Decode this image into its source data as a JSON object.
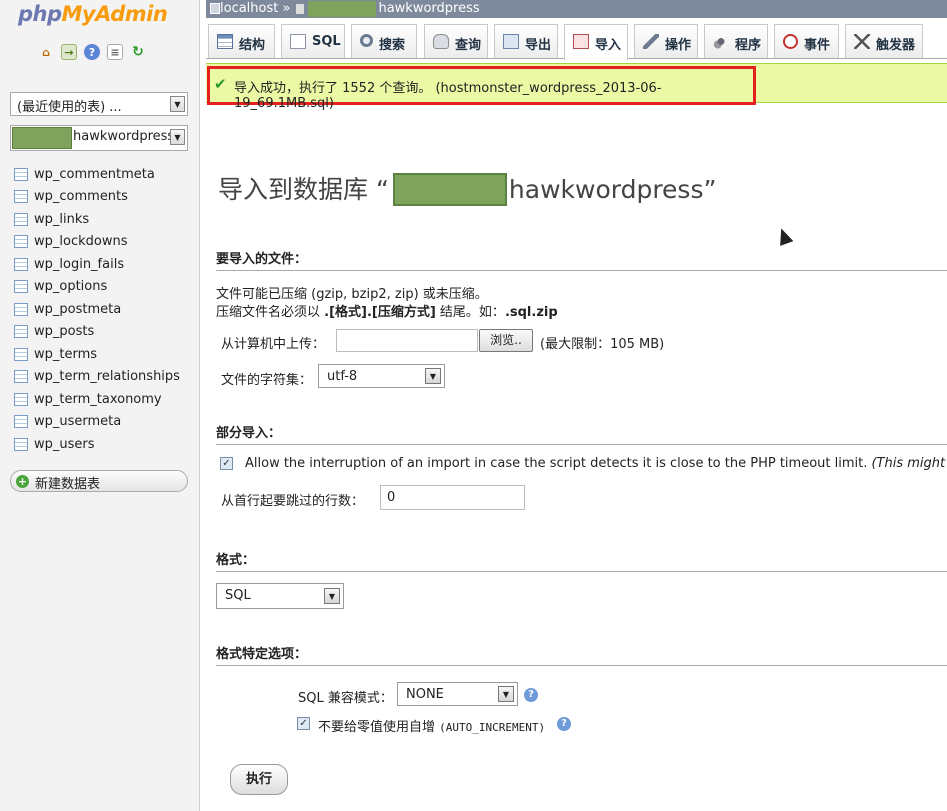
{
  "sidebar": {
    "logo": {
      "part1": "php",
      "part2": "MyAdmin"
    },
    "quick_icons": [
      "home-icon",
      "exit-icon",
      "help-icon",
      "docs-icon",
      "reload-icon"
    ],
    "recent_select": "(最近使用的表) ...",
    "db_select": "hawkwordpress",
    "tables": [
      "wp_commentmeta",
      "wp_comments",
      "wp_links",
      "wp_lockdowns",
      "wp_login_fails",
      "wp_options",
      "wp_postmeta",
      "wp_posts",
      "wp_terms",
      "wp_term_relationships",
      "wp_term_taxonomy",
      "wp_usermeta",
      "wp_users"
    ],
    "new_table": "新建数据表"
  },
  "breadcrumb": {
    "server": "localhost",
    "separator": "»",
    "db": "hawkwordpress"
  },
  "tabs": [
    {
      "label": "结构",
      "icon": "structure-icon"
    },
    {
      "label": "SQL",
      "icon": "sql-icon"
    },
    {
      "label": "搜索",
      "icon": "search-icon"
    },
    {
      "label": "查询",
      "icon": "query-icon"
    },
    {
      "label": "导出",
      "icon": "export-icon"
    },
    {
      "label": "导入",
      "icon": "import-icon",
      "active": true
    },
    {
      "label": "操作",
      "icon": "operations-icon"
    },
    {
      "label": "程序",
      "icon": "routines-icon"
    },
    {
      "label": "事件",
      "icon": "events-icon"
    },
    {
      "label": "触发器",
      "icon": "triggers-icon"
    }
  ],
  "notice": {
    "text": "导入成功，执行了 1552 个查询。 (hostmonster_wordpress_2013-06-19_69.1MB.sql)"
  },
  "page": {
    "title_prefix": "导入到数据库 “",
    "title_db": "hawkwordpress",
    "title_suffix": "”"
  },
  "file_section": {
    "heading": "要导入的文件：",
    "line1": "文件可能已压缩 (gzip, bzip2, zip) 或未压缩。",
    "line2_a": "压缩文件名必须以 ",
    "line2_b": ".[格式].[压缩方式]",
    "line2_c": " 结尾。如：",
    "line2_d": ".sql.zip",
    "upload_label": "从计算机中上传：",
    "upload_value": "",
    "browse_label": "浏览..",
    "max_limit": "(最大限制：105 MB)",
    "charset_label": "文件的字符集：",
    "charset_value": "utf-8"
  },
  "partial_section": {
    "heading": "部分导入：",
    "allow_interrupt": "Allow the interruption of an import in case the script detects it is close to the PHP timeout limit.",
    "allow_interrupt_note": "(This might be a",
    "allow_interrupt_checked": true,
    "skip_label": "从首行起要跳过的行数：",
    "skip_value": "0"
  },
  "format_section": {
    "heading": "格式：",
    "value": "SQL"
  },
  "options_section": {
    "heading": "格式特定选项：",
    "compat_label": "SQL 兼容模式：",
    "compat_value": "NONE",
    "autoinc_label": "不要给零值使用自增",
    "autoinc_code": "(AUTO_INCREMENT)",
    "autoinc_checked": true
  },
  "go_button": "执行"
}
